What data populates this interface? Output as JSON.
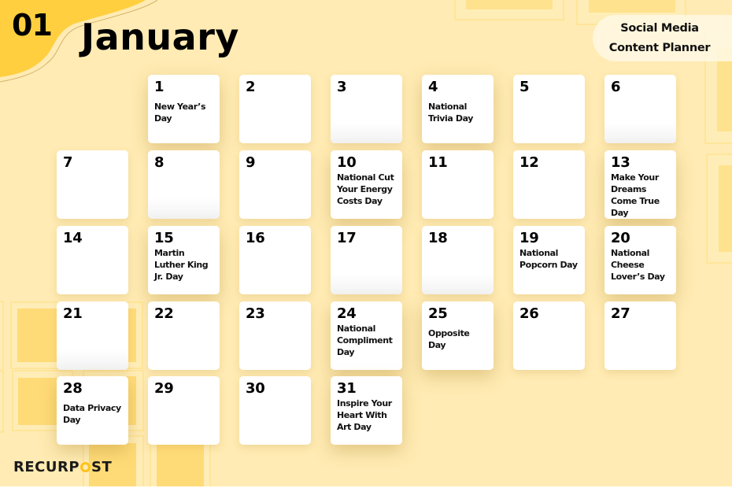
{
  "header": {
    "month_number": "01",
    "month_name": "January",
    "planner_title_line1": "Social Media",
    "planner_title_line2": "Content Planner"
  },
  "colors": {
    "background": "#ffebb3",
    "accent_yellow": "#ffcf3f",
    "deco_square": "#ffdb78",
    "card": "#ffffff",
    "text": "#000000",
    "logo_accent": "#ffc21a"
  },
  "calendar": {
    "days": [
      {
        "day": "1",
        "event": "New Year’s Day"
      },
      {
        "day": "2",
        "event": ""
      },
      {
        "day": "3",
        "event": ""
      },
      {
        "day": "4",
        "event": "National Trivia Day"
      },
      {
        "day": "5",
        "event": ""
      },
      {
        "day": "6",
        "event": ""
      },
      {
        "day": "7",
        "event": ""
      },
      {
        "day": "8",
        "event": ""
      },
      {
        "day": "9",
        "event": ""
      },
      {
        "day": "10",
        "event": "National Cut Your Energy Costs Day"
      },
      {
        "day": "11",
        "event": ""
      },
      {
        "day": "12",
        "event": ""
      },
      {
        "day": "13",
        "event": "Make Your Dreams Come True Day"
      },
      {
        "day": "14",
        "event": ""
      },
      {
        "day": "15",
        "event": "Martin Luther King Jr. Day"
      },
      {
        "day": "16",
        "event": ""
      },
      {
        "day": "17",
        "event": ""
      },
      {
        "day": "18",
        "event": ""
      },
      {
        "day": "19",
        "event": "National Popcorn Day"
      },
      {
        "day": "20",
        "event": "National Cheese Lover’s Day"
      },
      {
        "day": "21",
        "event": ""
      },
      {
        "day": "22",
        "event": ""
      },
      {
        "day": "23",
        "event": ""
      },
      {
        "day": "24",
        "event": "National Compliment Day"
      },
      {
        "day": "25",
        "event": "Opposite Day"
      },
      {
        "day": "26",
        "event": ""
      },
      {
        "day": "27",
        "event": ""
      },
      {
        "day": "28",
        "event": "Data Privacy Day"
      },
      {
        "day": "29",
        "event": ""
      },
      {
        "day": "30",
        "event": ""
      },
      {
        "day": "31",
        "event": "Inspire Your Heart With Art Day"
      }
    ]
  },
  "footer": {
    "logo_text_before": "RECURP",
    "logo_text_after": "ST",
    "logo_icon": "clock-o-icon"
  }
}
